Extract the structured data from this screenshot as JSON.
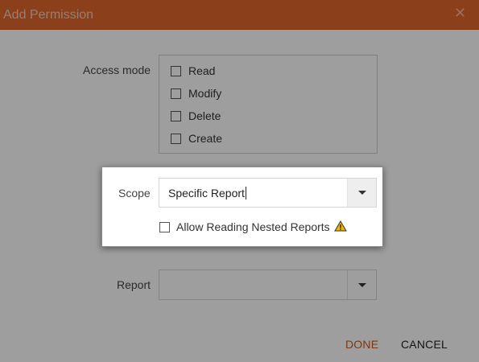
{
  "dialog": {
    "title": "Add Permission",
    "close_glyph": "✕"
  },
  "access_mode": {
    "label": "Access mode",
    "options": [
      {
        "label": "Read",
        "checked": false
      },
      {
        "label": "Modify",
        "checked": false
      },
      {
        "label": "Delete",
        "checked": false
      },
      {
        "label": "Create",
        "checked": false
      }
    ]
  },
  "scope": {
    "label": "Scope",
    "value": "Specific Report",
    "nested_option": {
      "label": "Allow Reading Nested Reports",
      "checked": false
    }
  },
  "report": {
    "label": "Report",
    "value": ""
  },
  "footer": {
    "done_label": "DONE",
    "cancel_label": "CANCEL"
  },
  "colors": {
    "accent": "#e0662a",
    "done_text": "#c35a2a",
    "warning": "#f0b400"
  }
}
